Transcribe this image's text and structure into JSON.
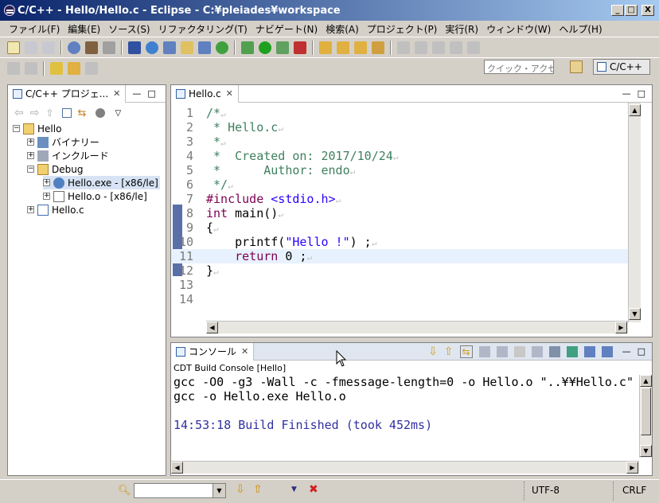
{
  "window": {
    "title": "C/C++ - Hello/Hello.c - Eclipse - C:¥pleiades¥workspace",
    "min": "_",
    "max": "□",
    "close": "X"
  },
  "menu": [
    "ファイル(F)",
    "編集(E)",
    "ソース(S)",
    "リファクタリング(T)",
    "ナビゲート(N)",
    "検索(A)",
    "プロジェクト(P)",
    "実行(R)",
    "ウィンドウ(W)",
    "ヘルプ(H)"
  ],
  "toolbar": {
    "quick_access_placeholder": "クイック・アクセス",
    "perspective": "C/C++"
  },
  "project_explorer": {
    "tab": "C/C++ プロジェ...",
    "tree": [
      {
        "label": "Hello"
      },
      {
        "label": "バイナリー"
      },
      {
        "label": "インクルード"
      },
      {
        "label": "Debug"
      },
      {
        "label": "Hello.exe - [x86/le]"
      },
      {
        "label": "Hello.o - [x86/le]"
      },
      {
        "label": "Hello.c"
      }
    ]
  },
  "editor": {
    "tab": "Hello.c",
    "line_numbers": [
      "1",
      "2",
      "3",
      "4",
      "5",
      "6",
      "7",
      "8",
      "9",
      "10",
      "11",
      "12",
      "13",
      "14"
    ]
  },
  "console": {
    "tab": "コンソール",
    "title": "CDT Build Console [Hello]",
    "lines": [
      "gcc -O0 -g3 -Wall -c -fmessage-length=0 -o Hello.o \"..¥¥Hello.c\"",
      "gcc -o Hello.exe Hello.o",
      "",
      "14:53:18 Build Finished (took 452ms)"
    ]
  },
  "statusbar": {
    "encoding": "UTF-8",
    "line_ending": "CRLF"
  },
  "colors": {
    "accent": "#0a246a",
    "selection": "#d7e3f4",
    "comment": "#3f7f5f",
    "keyword": "#7f0055",
    "console_blue": "#3030a0"
  }
}
